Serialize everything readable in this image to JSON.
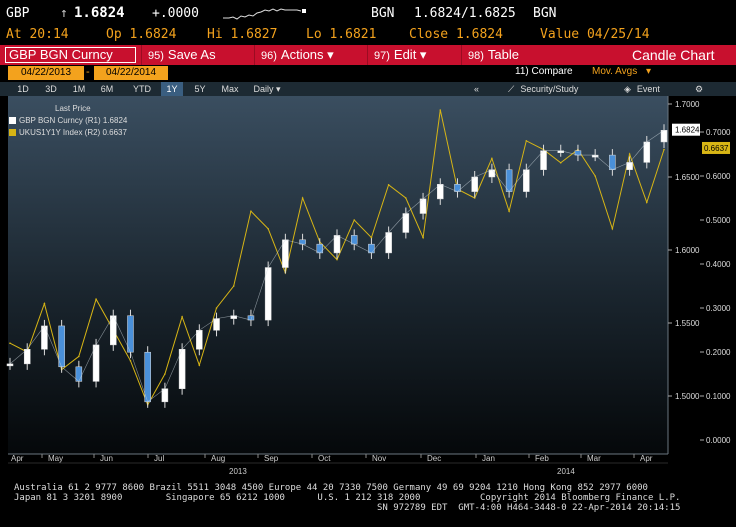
{
  "quote": {
    "ticker": "GBP",
    "arrow": "↑",
    "last": "1.6824",
    "change": "+.0000",
    "source": "BGN",
    "bid_ask": "1.6824/1.6825",
    "source2": "BGN",
    "at": "At 20:14",
    "open": "Op 1.6824",
    "high": "Hi 1.6827",
    "low": "Lo 1.6821",
    "close": "Close 1.6824",
    "value": "Value 04/25/14"
  },
  "toolbar": {
    "security": "GBP BGN Curncy",
    "buttons": [
      {
        "num": "95)",
        "label": "Save As"
      },
      {
        "num": "96)",
        "label": "Actions ▾"
      },
      {
        "num": "97)",
        "label": "Edit ▾"
      },
      {
        "num": "98)",
        "label": "Table"
      }
    ],
    "chart_type": "Candle Chart"
  },
  "dates": {
    "start": "04/22/2013",
    "dash": "-",
    "end": "04/22/2014",
    "compare": "11) Compare",
    "mov_avgs": "Mov. Avgs"
  },
  "periods": {
    "items": [
      "1D",
      "3D",
      "1M",
      "6M",
      "YTD",
      "1Y",
      "5Y",
      "Max"
    ],
    "selected": "1Y",
    "frequency": "Daily ▾",
    "collapse": "«",
    "security_study": "Security/Study",
    "event": "Event",
    "gear": "⚙"
  },
  "legend": {
    "title": "Last Price",
    "series": [
      {
        "label": "GBP BGN Curncy (R1)  1.6824",
        "color": "#ffffff"
      },
      {
        "label": "UKUS1Y1Y Index (R2) 0.6637",
        "color": "#d7b515"
      }
    ]
  },
  "axis": {
    "right1": [
      "1.7000",
      "1.6500",
      "1.6000",
      "1.5500",
      "1.5000"
    ],
    "right2": [
      "0.7000",
      "0.6000",
      "0.5000",
      "0.4000",
      "0.3000",
      "0.2000",
      "0.1000",
      "0.0000"
    ],
    "last_tag1": "1.6824",
    "last_tag2": "0.6637",
    "months": [
      "Apr",
      "May",
      "Jun",
      "Jul",
      "Aug",
      "Sep",
      "Oct",
      "Nov",
      "Dec",
      "Jan",
      "Feb",
      "Mar",
      "Apr"
    ],
    "years": [
      "2013",
      "2014"
    ]
  },
  "chart_data": {
    "type": "line",
    "x": [
      "2013-04-22",
      "2013-05-01",
      "2013-05-10",
      "2013-05-20",
      "2013-05-29",
      "2013-06-07",
      "2013-06-17",
      "2013-06-26",
      "2013-07-05",
      "2013-07-15",
      "2013-07-24",
      "2013-08-02",
      "2013-08-12",
      "2013-08-21",
      "2013-08-30",
      "2013-09-09",
      "2013-09-18",
      "2013-09-27",
      "2013-10-07",
      "2013-10-16",
      "2013-10-25",
      "2013-11-04",
      "2013-11-13",
      "2013-11-22",
      "2013-12-02",
      "2013-12-11",
      "2013-12-20",
      "2013-12-31",
      "2014-01-09",
      "2014-01-20",
      "2014-01-29",
      "2014-02-07",
      "2014-02-18",
      "2014-02-27",
      "2014-03-10",
      "2014-03-19",
      "2014-03-28",
      "2014-04-08",
      "2014-04-22"
    ],
    "series": [
      {
        "name": "GBP BGN Curncy (R1)",
        "axis": "right1",
        "values": [
          1.522,
          1.532,
          1.548,
          1.52,
          1.51,
          1.535,
          1.555,
          1.53,
          1.496,
          1.505,
          1.532,
          1.545,
          1.553,
          1.555,
          1.552,
          1.588,
          1.607,
          1.604,
          1.598,
          1.61,
          1.604,
          1.598,
          1.612,
          1.625,
          1.635,
          1.645,
          1.64,
          1.65,
          1.655,
          1.64,
          1.655,
          1.668,
          1.668,
          1.665,
          1.665,
          1.655,
          1.66,
          1.674,
          1.682
        ]
      },
      {
        "name": "UKUS1Y1Y Index (R2)",
        "axis": "right2",
        "values": [
          0.22,
          0.2,
          0.31,
          0.16,
          0.19,
          0.32,
          0.25,
          0.18,
          0.08,
          0.15,
          0.28,
          0.17,
          0.3,
          0.35,
          0.52,
          0.48,
          0.38,
          0.55,
          0.45,
          0.41,
          0.5,
          0.46,
          0.58,
          0.55,
          0.46,
          0.75,
          0.57,
          0.55,
          0.64,
          0.52,
          0.68,
          0.66,
          0.63,
          0.66,
          0.6,
          0.48,
          0.65,
          0.54,
          0.66
        ]
      }
    ],
    "ylim_right1": [
      1.49,
      1.705
    ],
    "ylim_right2": [
      0.0,
      0.72
    ],
    "legend_position": "top-left",
    "grid": false
  },
  "footer": {
    "line1": "Australia 61 2 9777 8600 Brazil 5511 3048 4500 Europe 44 20 7330 7500 Germany 49 69 9204 1210 Hong Kong 852 2977 6000",
    "line2": "Japan 81 3 3201 8900        Singapore 65 6212 1000      U.S. 1 212 318 2000           Copyright 2014 Bloomberg Finance L.P.",
    "line3": "SN 972789 EDT  GMT-4:00 H464-3448-0 22-Apr-2014 20:14:15"
  },
  "colors": {
    "accent_orange": "#f3a21d",
    "toolbar_red": "#c8102e",
    "series1": "#ffffff",
    "series1_up": "#4a90d9",
    "series2": "#d7b515"
  }
}
